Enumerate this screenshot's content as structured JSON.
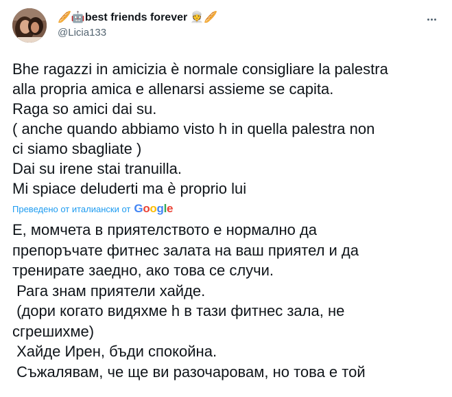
{
  "tweet": {
    "display_name": "best friends forever",
    "emoji_left_1": "🥖",
    "emoji_left_2": "🤖",
    "emoji_right_1": "👳",
    "emoji_right_2": "🥖",
    "handle": "@Licia133",
    "original_lines": [
      "Bhe ragazzi in amicizia è normale consigliare la palestra",
      "alla propria amica e allenarsi assieme se capita.",
      "Raga so amici dai su.",
      "( anche quando abbiamo visto h in quella palestra non",
      "ci siamo sbagliate )",
      "Dai su irene stai tranuilla.",
      "Mi spiace deluderti ma è proprio lui"
    ],
    "translated_label": "Преведено от италиански от",
    "translation_provider": "Google",
    "translated_lines": [
      "Е, момчета в приятелството е нормално да",
      "препоръчате фитнес залата на ваш приятел и да",
      "тренирате заедно, ако това се случи.",
      " Рага знам приятели хайде.",
      " (дори когато видяхме h в тази фитнес зала, не",
      "сгрешихме)",
      " Хайде Ирен, бъди спокойна.",
      " Съжалявам, че ще ви разочаровам, но това е той"
    ]
  },
  "colors": {
    "link": "#1d9bf0",
    "secondary_text": "#536471",
    "primary_text": "#0f1419"
  },
  "icons": {
    "more": "more-dots-icon",
    "avatar": "profile-photo"
  }
}
